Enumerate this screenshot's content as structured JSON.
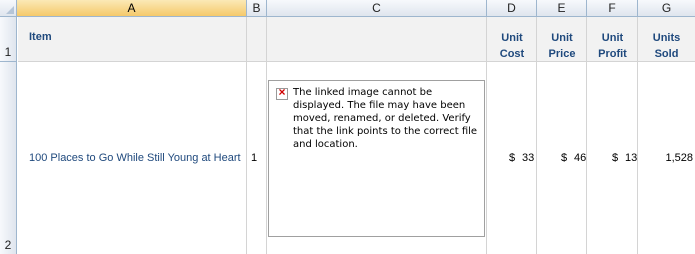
{
  "columns": [
    "A",
    "B",
    "C",
    "D",
    "E",
    "F",
    "G"
  ],
  "selected_column": "A",
  "rows": [
    "1",
    "2"
  ],
  "headers": {
    "item": "Item",
    "unit_cost": [
      "Unit",
      "Cost"
    ],
    "unit_price": [
      "Unit",
      "Price"
    ],
    "unit_profit": [
      "Unit",
      "Profit"
    ],
    "units_sold": [
      "Units",
      "Sold"
    ]
  },
  "row2": {
    "item": "100 Places to Go While Still Young at Heart",
    "b_value": "1",
    "image_error": "The linked image cannot be displayed. The file may have been moved, renamed, or deleted. Verify that the link points to the correct file and location.",
    "unit_cost": {
      "symbol": "$",
      "value": "33"
    },
    "unit_price": {
      "symbol": "$",
      "value": "46"
    },
    "unit_profit": {
      "symbol": "$",
      "value": "13"
    },
    "units_sold": "1,528"
  },
  "colors": {
    "header_text": "#1f497d",
    "selected_col": "#f5c96b",
    "grid": "#d4d4d4"
  },
  "icons": {
    "broken_image": "broken-image-icon"
  }
}
